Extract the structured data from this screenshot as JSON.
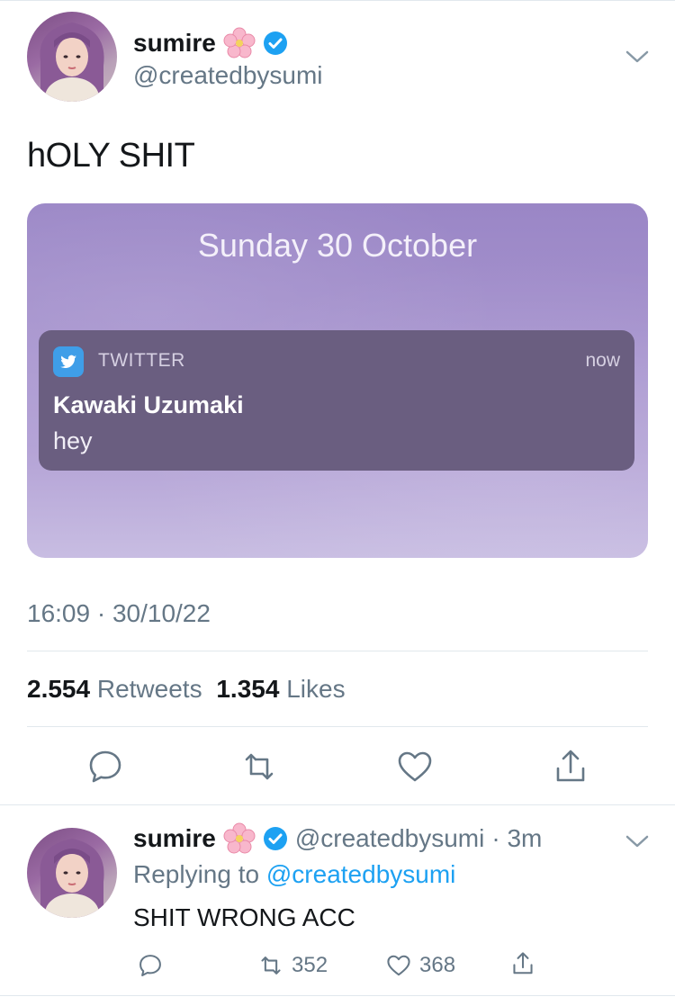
{
  "tweet": {
    "author_name": "sumire",
    "author_handle": "@createdbysumi",
    "text": "hOLY SHIT",
    "timestamp": "16:09 · 30/10/22",
    "retweets_count": "2.554",
    "retweets_label": "Retweets",
    "likes_count": "1.354",
    "likes_label": "Likes"
  },
  "media": {
    "date": "Sunday 30 October",
    "notification": {
      "app": "TWITTER",
      "time": "now",
      "title": "Kawaki Uzumaki",
      "body": "hey"
    }
  },
  "reply": {
    "author_name": "sumire",
    "author_handle": "@createdbysumi",
    "time": "· 3m",
    "replying_prefix": "Replying to",
    "replying_handle": "@createdbysumi",
    "text": "SHIT WRONG ACC",
    "retweets": "352",
    "likes": "368"
  },
  "icons": {
    "verified": "verified-badge-icon",
    "flower": "cherry-blossom-emoji",
    "chevron": "chevron-down-icon",
    "reply": "reply-bubble-icon",
    "retweet": "retweet-icon",
    "like": "heart-icon",
    "share": "share-icon"
  },
  "colors": {
    "accent": "#1da1f2",
    "secondary_text": "#657786",
    "divider": "#e1e8ed"
  }
}
